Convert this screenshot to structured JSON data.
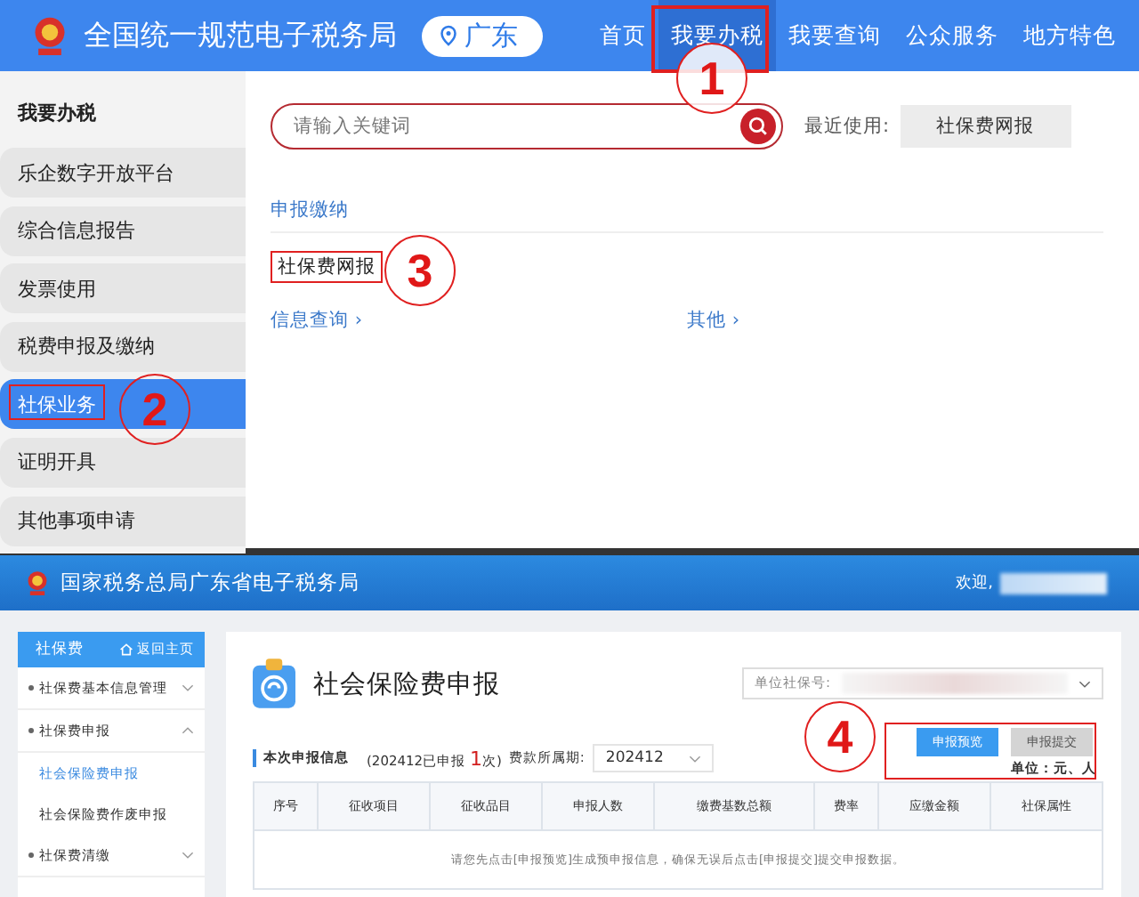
{
  "top_site": {
    "title": "全国统一规范电子税务局",
    "location": "广东",
    "nav": [
      {
        "label": "首页",
        "selected": false
      },
      {
        "label": "我要办税",
        "selected": true
      },
      {
        "label": "我要查询",
        "selected": false
      },
      {
        "label": "公众服务",
        "selected": false
      },
      {
        "label": "地方特色",
        "selected": false
      }
    ],
    "sidebar": {
      "heading": "我要办税",
      "items": [
        {
          "label": "乐企数字开放平台",
          "selected": false
        },
        {
          "label": "综合信息报告",
          "selected": false
        },
        {
          "label": "发票使用",
          "selected": false
        },
        {
          "label": "税费申报及缴纳",
          "selected": false
        },
        {
          "label": "社保业务",
          "selected": true
        },
        {
          "label": "证明开具",
          "selected": false
        },
        {
          "label": "其他事项申请",
          "selected": false
        }
      ]
    },
    "search": {
      "placeholder": "请输入关键词"
    },
    "recent_label": "最近使用:",
    "recent_button": "社保费网报",
    "section": "申报缴纳",
    "service_link": "社保费网报",
    "more_links": [
      "信息查询",
      "其他"
    ],
    "chevron": "›"
  },
  "bottom_site": {
    "title": "国家税务总局广东省电子税务局",
    "welcome": "欢迎,",
    "sidebar": {
      "title": "社保费",
      "home_link": "返回主页",
      "items": [
        {
          "kind": "group",
          "label": "社保费基本信息管理",
          "expanded": false
        },
        {
          "kind": "group",
          "label": "社保费申报",
          "expanded": true
        },
        {
          "kind": "sub",
          "label": "社会保险费申报",
          "selected": true
        },
        {
          "kind": "sub",
          "label": "社会保险费作废申报",
          "selected": false
        },
        {
          "kind": "group",
          "label": "社保费清缴",
          "expanded": false
        }
      ]
    },
    "page_title": "社会保险费申报",
    "unit_label": "单位社保号:",
    "buttons": [
      {
        "label": "申报预览",
        "disabled": false
      },
      {
        "label": "申报提交",
        "disabled": true
      }
    ],
    "info_title": "本次申报信息",
    "declared_prefix": "(202412已申报",
    "declared_count": "1",
    "declared_suffix": "次)",
    "period_label": "费款所属期:",
    "period_value": "202412",
    "unit_note": "单位：元、人",
    "table": {
      "columns": [
        "序号",
        "征收项目",
        "征收品目",
        "申报人数",
        "缴费基数总额",
        "费率",
        "应缴金额",
        "社保属性"
      ],
      "empty_message": "请您先点击[申报预览]生成预申报信息，确保无误后点击[申报提交]提交申报数据。"
    }
  },
  "annotations": [
    "1",
    "2",
    "3",
    "4"
  ]
}
